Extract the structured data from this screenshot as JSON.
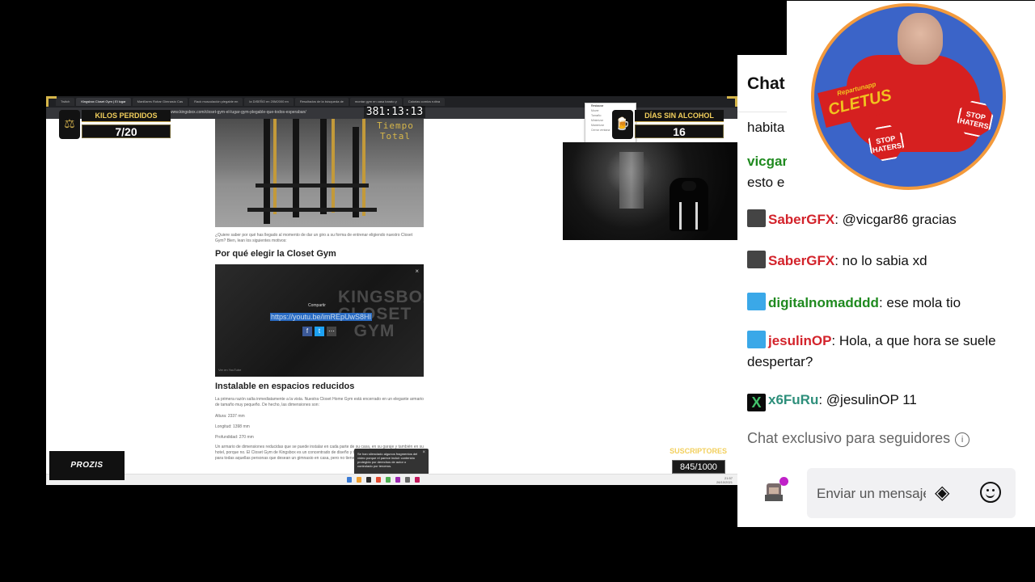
{
  "browser": {
    "tabs": [
      "Twitch",
      "Kingsbox Closet Gym | El lugar",
      "Manillares Robar Gimnasio Cas",
      "Rack musculación plegable en",
      "la DISEÑO en 20M2000 en",
      "Resultados de la búsqueda de",
      "montar gym en casa barato y",
      "Calorias comics rutina"
    ],
    "url": "www.kingsbox.com/closet-gym-el-lugar-gym-plegable-que-todos-esperaban/"
  },
  "article": {
    "intro": "¿Quiere saber por qué has llegado al momento de dar un giro a su forma de entrenar eligiendo nuestro Closet Gym? Bien, lean los siguientes motivos:",
    "heading1": "Por qué elegir la Closet Gym",
    "heading2": "Instalable en espacios reducidos",
    "p1": "La primera razón salta inmediatamente a la vista. Nuestra Closet Home Gym está encerrado en un elegante armario de tamaño muy pequeño. De hecho, las dimensiones son:",
    "height": "Altura: 2337 mm",
    "length": "Longitud: 1398 mm",
    "depth": "Profundidad: 270 mm",
    "p2": "Un armario de dimensiones reducidas que se puede instalar en cada parte de su casa, en su garaje y también en su hotel, porque no. El Closet Gym de Kingsbox es un concentrado de diseño y tecnología. Diseñado especialmente para todas aquellas personas que desean un gimnasio en casa, pero no tienen mucho espacio."
  },
  "video": {
    "big_text": "KINGSBOX CLOSET GYM",
    "share_label": "Compartir",
    "share_link": "https://youtu.be/imREpUwS8HI",
    "brand": "Ver en YouTube",
    "close": "×"
  },
  "muted_toast": {
    "text": "Se han silenciado algunos fragmentos del vídeo porque el parece incluir contenido protegido por derechos de autor o controlado por terceros.",
    "close": "×"
  },
  "context_menu": [
    "Restaurar",
    "Mover",
    "Tamaño",
    "Minimizar",
    "Maximizar",
    "Cerrar ventana"
  ],
  "taskbar": {
    "time": "21:57",
    "date": "26/10/2021"
  },
  "overlay": {
    "kilos_label": "KILOS PERDIDOS",
    "kilos_value": "7/20",
    "alcohol_label": "DÍAS SIN ALCOHOL",
    "alcohol_value": "16",
    "timer_value": "381:13:13",
    "timer_label": "Tiempo Total",
    "sponsor": "PROZIS",
    "subs_label": "SUSCRIPTORES",
    "subs_value": "845/1000"
  },
  "chat": {
    "title": "Chat",
    "partial_1": "habita",
    "partial_user": "vicgar",
    "partial_2": "esto e",
    "messages": [
      {
        "user": "SaberGFX",
        "text": ": @vicgar86 gracias",
        "badge": "wolf-icon"
      },
      {
        "user": "SaberGFX",
        "text": ": no lo sabia xd",
        "badge": "wolf-icon"
      },
      {
        "user": "digitalnomadddd",
        "text": ": ese mola tio",
        "badge": "crown-icon"
      },
      {
        "user": "jesulinOP",
        "text": ": Hola, a que hora se suele despertar?",
        "badge": "crown-icon"
      },
      {
        "user": "x6FuRu",
        "text": ": @jesulinOP 11",
        "badge": "x-icon"
      }
    ],
    "followers_only": "Chat exclusivo para seguidores",
    "input_placeholder": "Enviar un mensaje"
  },
  "logo": {
    "banner_top": "Repartunapp",
    "banner_main": "CLETUS",
    "stop_left": "STOP HATERS",
    "stop_right": "STOP HATERS"
  },
  "colors": {
    "accent_gold": "#f2cf5c",
    "chat_user_red": "#d3232b",
    "chat_user_green": "#1f8a1f",
    "logo_blue": "#3b64c8",
    "logo_red": "#d62020"
  }
}
